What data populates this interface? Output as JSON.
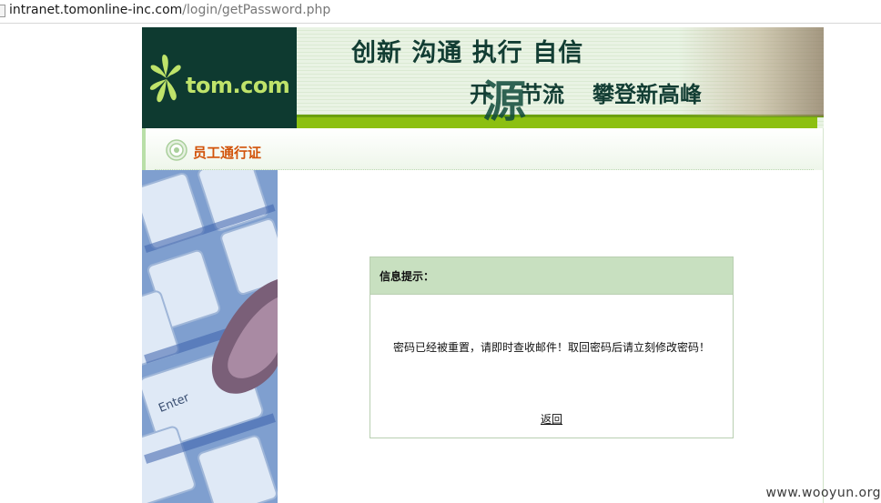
{
  "browser": {
    "url_host": "intranet.tomonline-inc.com",
    "url_path": "/login/getPassword.php"
  },
  "header": {
    "logo_text": "tom.com",
    "slogan_line1": "创新 沟通 执行 自信",
    "slogan_kai": "开",
    "slogan_big_char": "源",
    "slogan_jieliu": "节流",
    "slogan_climb": "攀登新高峰"
  },
  "section": {
    "title": "员工通行证"
  },
  "message": {
    "header": "信息提示：",
    "body": "密码已经被重置，请即时查收邮件！取回密码后请立刻修改密码！",
    "back_link": "返回"
  },
  "watermark": "www.wooyun.org",
  "colors": {
    "logo_bg": "#0e3a30",
    "logo_text": "#bfe36a",
    "accent_green": "#8cc011",
    "section_title": "#d2530a",
    "msg_header_bg": "#c8e0c0"
  },
  "icons": {
    "logo": "tom-asterisk-logo",
    "section": "target-rings-icon",
    "page": "page-icon"
  }
}
